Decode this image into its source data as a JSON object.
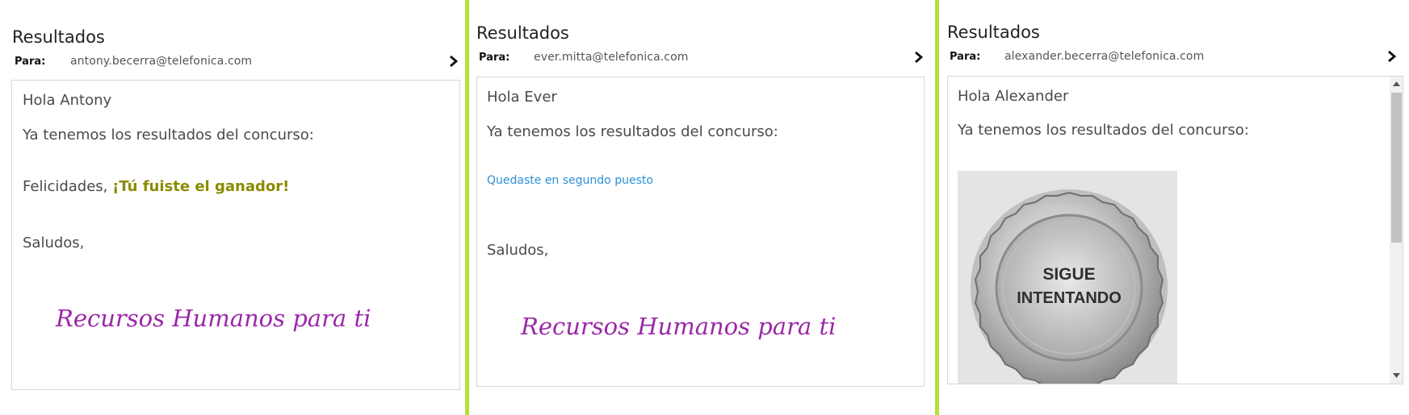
{
  "panels": [
    {
      "title": "Resultados",
      "para_label": "Para:",
      "email": "antony.becerra@telefonica.com",
      "greeting": "Hola Antony",
      "intro": "Ya tenemos los resultados del concurso:",
      "result_prefix": "Felicidades, ",
      "result_highlight": "¡Tú fuiste el ganador!",
      "closing": "Saludos,",
      "signature": "Recursos Humanos para ti"
    },
    {
      "title": "Resultados",
      "para_label": "Para:",
      "email": "ever.mitta@telefonica.com",
      "greeting": "Hola Ever",
      "intro": "Ya tenemos los resultados del concurso:",
      "result": "Quedaste en segundo puesto",
      "closing": "Saludos,",
      "signature": "Recursos Humanos para ti"
    },
    {
      "title": "Resultados",
      "para_label": "Para:",
      "email": "alexander.becerra@telefonica.com",
      "greeting": "Hola Alexander",
      "intro": "Ya tenemos los resultados del concurso:",
      "image_text_line1": "SIGUE",
      "image_text_line2": "INTENTANDO"
    }
  ],
  "colors": {
    "divider": "#b4e03a",
    "winner": "#8b8b00",
    "second_place": "#2a8fd8",
    "signature": "#9b27a8"
  },
  "icons": {
    "expand": "chevron-right-icon",
    "scroll_up": "scroll-up-arrow-icon",
    "scroll_down": "scroll-down-arrow-icon"
  }
}
